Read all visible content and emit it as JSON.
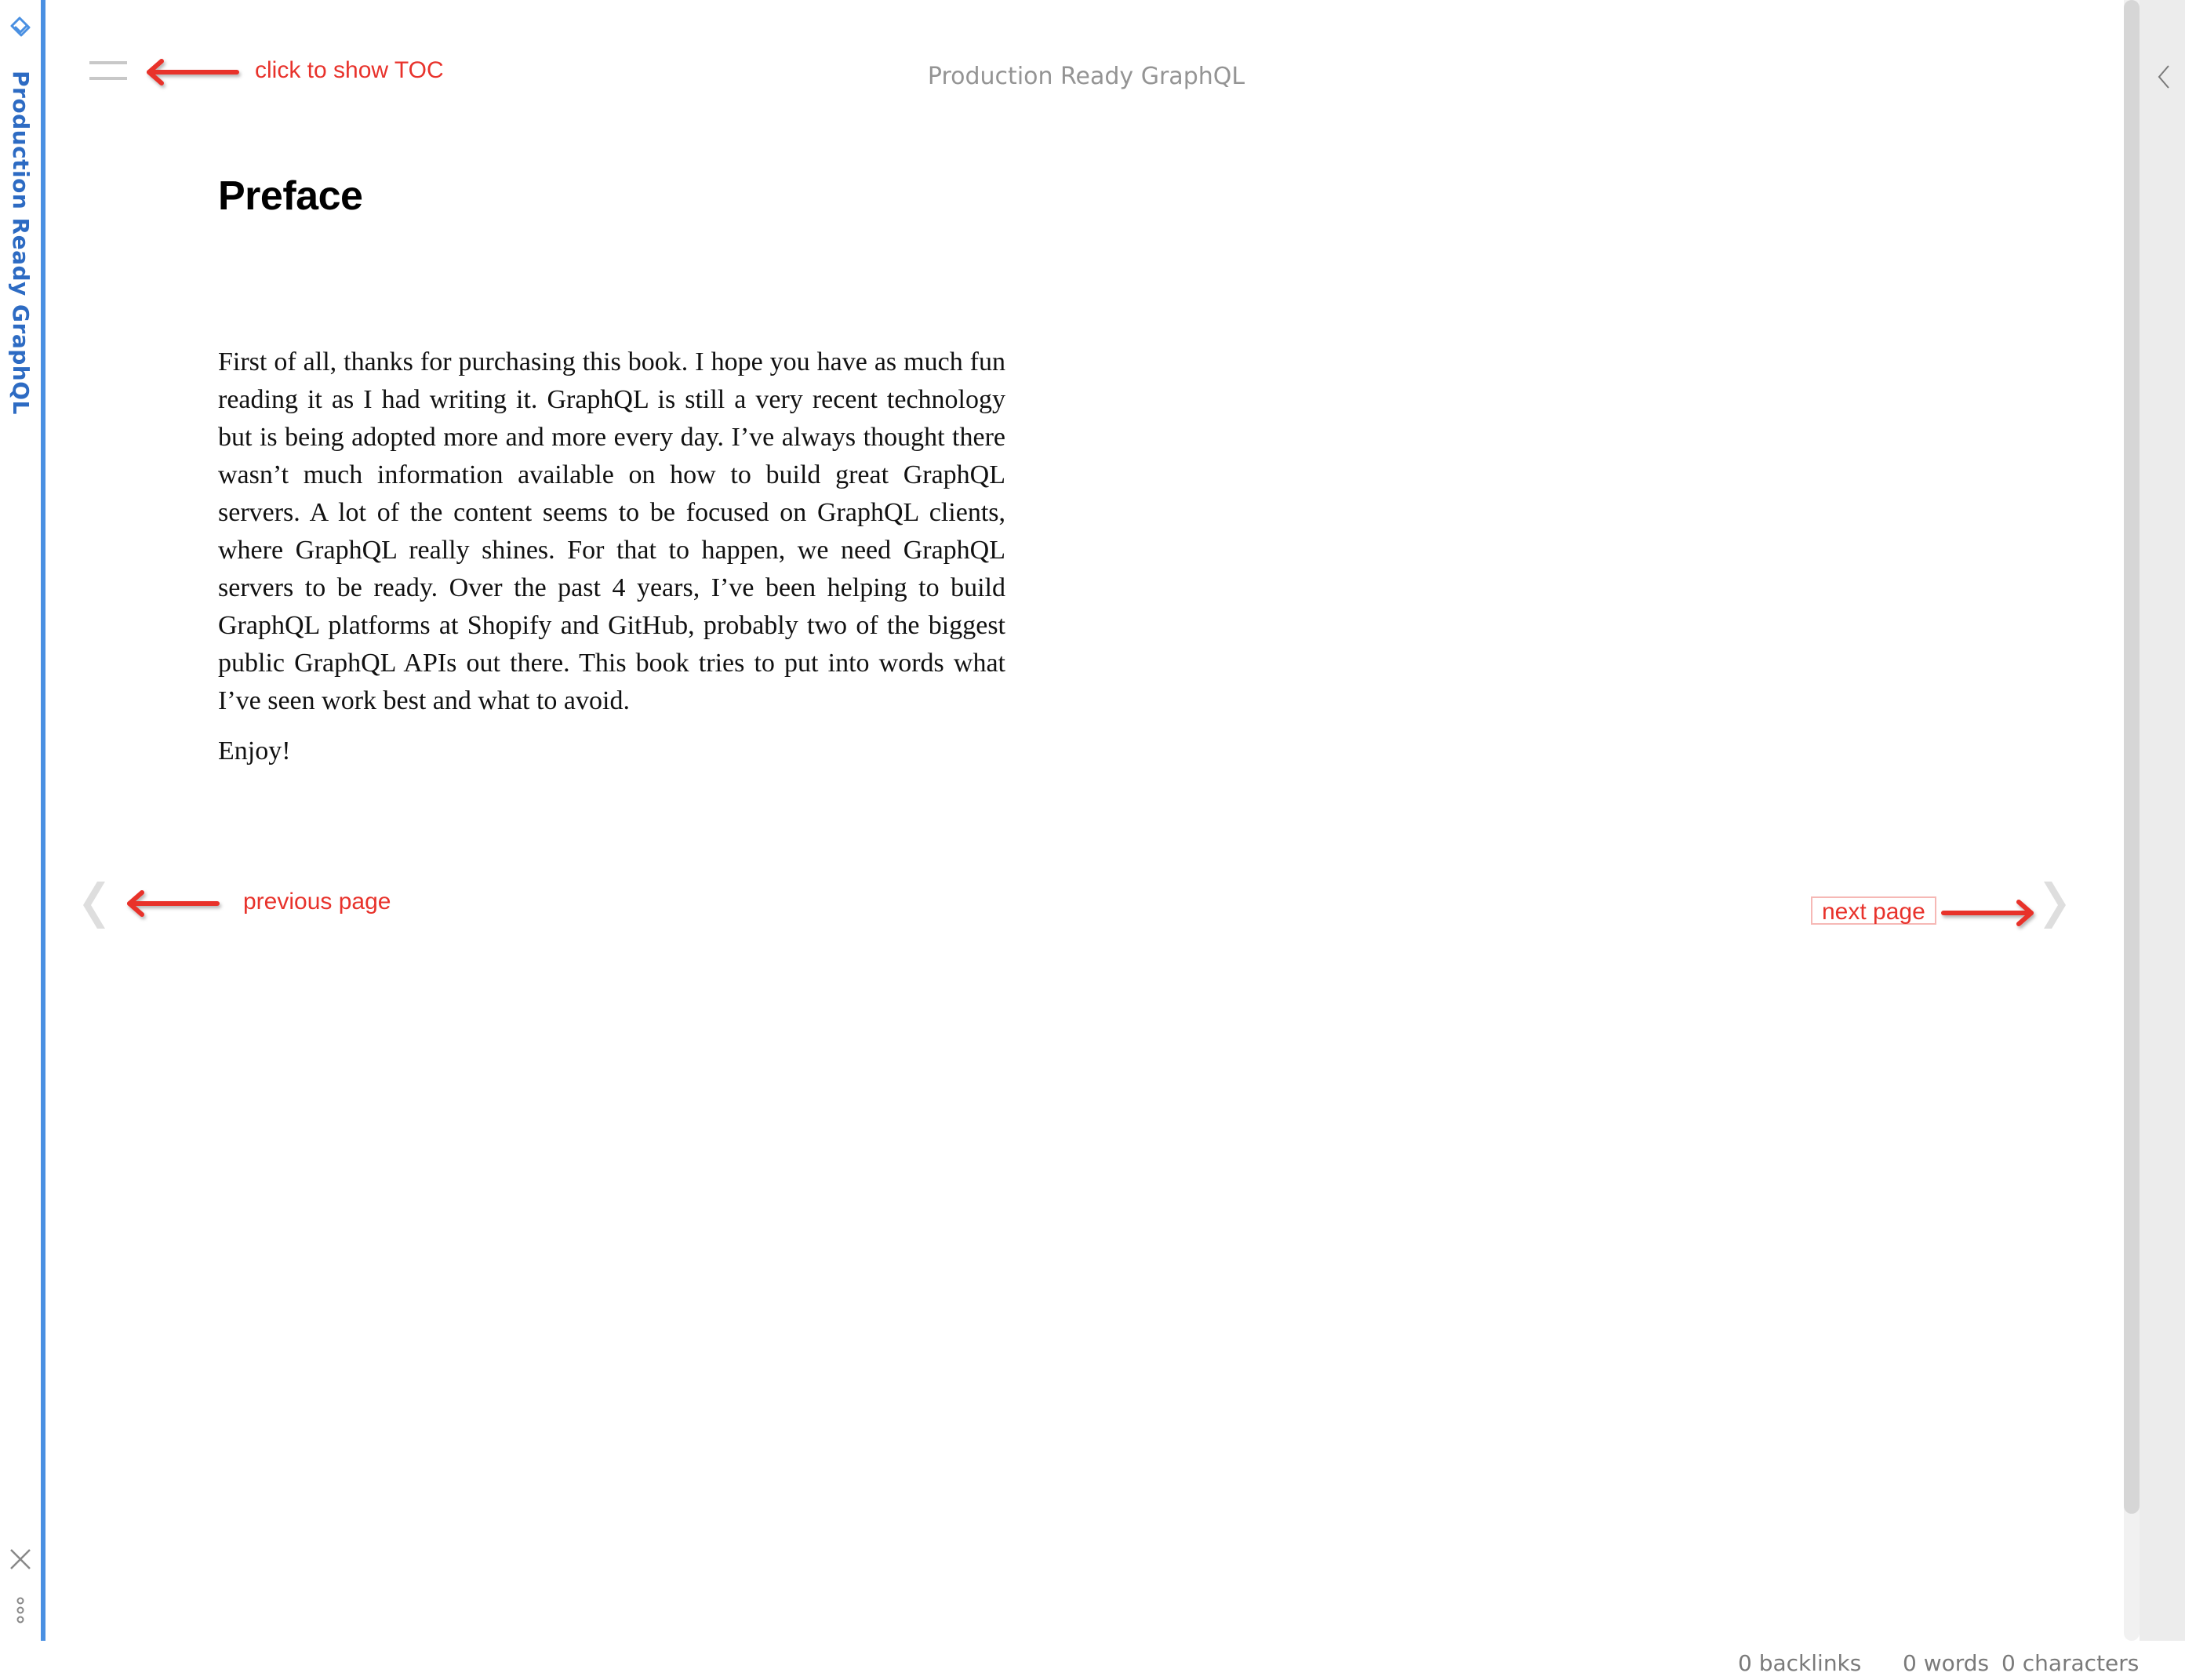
{
  "sidebar": {
    "vertical_title": "Production Ready GraphQL",
    "accent_color": "#4a90e2",
    "icons": {
      "logo": "app-logo-icon",
      "close": "close-icon",
      "more": "more-vertical-icon"
    }
  },
  "header": {
    "toc_button": "hamburger-menu-icon",
    "title": "Production Ready GraphQL",
    "expand_right_panel": "chevron-left-icon"
  },
  "annotations": {
    "color": "#e8322b",
    "toc": "click to show TOC",
    "previous": "previous page",
    "next": "next page"
  },
  "navigation": {
    "previous_icon": "chevron-left-icon",
    "next_icon": "chevron-right-icon"
  },
  "content": {
    "chapter_title": "Preface",
    "paragraphs": [
      "First of all, thanks for purchasing this book. I hope you have as much fun reading it as I had writing it. GraphQL is still a very recent technology but is being adopted more and more every day. I’ve always thought there wasn’t much information available on how to build great GraphQL servers. A lot of the content seems to be focused on GraphQL clients, where GraphQL really shines. For that to happen, we need GraphQL servers to be ready. Over the past 4 years, I’ve been helping to build GraphQL platforms at Shopify and GitHub, probably two of the biggest public GraphQL APIs out there. This book tries to put into words what I’ve seen work best and what to avoid.",
      "Enjoy!"
    ]
  },
  "status_bar": {
    "backlinks": "0 backlinks",
    "words": "0 words",
    "characters": "0 characters"
  }
}
